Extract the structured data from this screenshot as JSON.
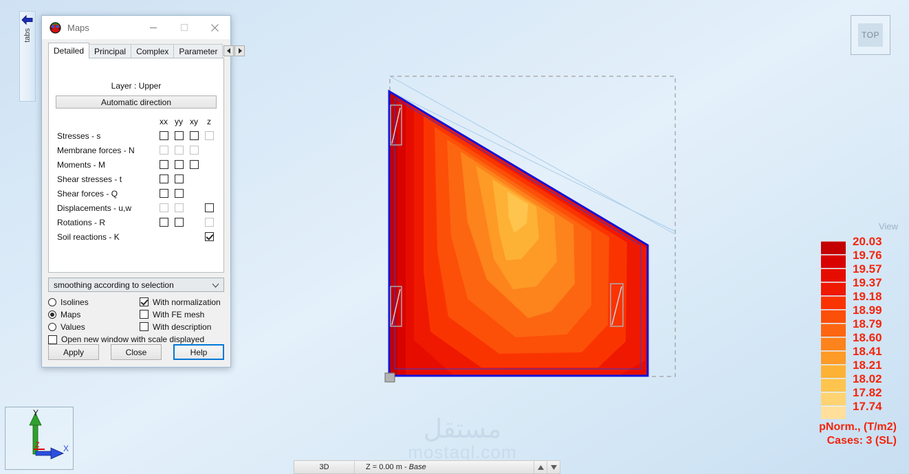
{
  "app": {
    "tabs_strip_label": "tabs",
    "tabs_strip_icon": "left-arrow-icon",
    "view_cube_label": "TOP",
    "view_label": "View",
    "watermark_arabic": "مستقل",
    "watermark_latin": "mostaql.com",
    "axis_labels": {
      "x": "X",
      "y": "Y",
      "z": "Z"
    }
  },
  "status_bar": {
    "mode": "3D",
    "z_prefix": "Z = 0.00 m - ",
    "z_suffix": "Base",
    "spin_up_icon": "triangle-up-icon",
    "spin_down_icon": "triangle-down-icon"
  },
  "dialog": {
    "title": "Maps",
    "icon": "maps-globe-icon",
    "minimize_icon": "minimize-icon",
    "maximize_icon": "maximize-icon",
    "close_icon": "close-icon",
    "tabs": [
      {
        "label": "Detailed",
        "active": true
      },
      {
        "label": "Principal",
        "active": false
      },
      {
        "label": "Complex",
        "active": false
      },
      {
        "label": "Parameter",
        "active": false
      }
    ],
    "tab_scroll_left_icon": "chevron-left-icon",
    "tab_scroll_right_icon": "chevron-right-icon",
    "layer_text": "Layer : Upper",
    "auto_direction_label": "Automatic direction",
    "component_headers": [
      "xx",
      "yy",
      "xy",
      "z"
    ],
    "component_rows": [
      {
        "label": "Stresses - s",
        "xx": "unchecked",
        "yy": "unchecked",
        "xy": "unchecked",
        "z": "disabled"
      },
      {
        "label": "Membrane forces - N",
        "xx": "disabled",
        "yy": "disabled",
        "xy": "disabled",
        "z": "none"
      },
      {
        "label": "Moments - M",
        "xx": "unchecked",
        "yy": "unchecked",
        "xy": "unchecked",
        "z": "none"
      },
      {
        "label": "Shear stresses - t",
        "xx": "unchecked",
        "yy": "unchecked",
        "xy": "none",
        "z": "none"
      },
      {
        "label": "Shear forces - Q",
        "xx": "unchecked",
        "yy": "unchecked",
        "xy": "none",
        "z": "none"
      },
      {
        "label": "Displacements - u,w",
        "xx": "disabled",
        "yy": "disabled",
        "xy": "none",
        "z": "unchecked"
      },
      {
        "label": "Rotations - R",
        "xx": "unchecked",
        "yy": "unchecked",
        "xy": "none",
        "z": "disabled"
      },
      {
        "label": "Soil reactions - K",
        "xx": "none",
        "yy": "none",
        "xy": "none",
        "z": "checked"
      }
    ],
    "smoothing_value": "smoothing according to selection",
    "smoothing_icon": "chevron-down-icon",
    "display_mode": [
      {
        "label": "Isolines",
        "selected": false
      },
      {
        "label": "Maps",
        "selected": true
      },
      {
        "label": "Values",
        "selected": false
      }
    ],
    "display_options": [
      {
        "label": "With normalization",
        "checked": true
      },
      {
        "label": "With FE mesh",
        "checked": false
      },
      {
        "label": "With description",
        "checked": false
      }
    ],
    "open_new_window": {
      "label": "Open new window with scale displayed",
      "checked": false
    },
    "buttons": [
      {
        "label": "Apply",
        "default": false
      },
      {
        "label": "Close",
        "default": false
      },
      {
        "label": "Help",
        "default": true
      }
    ]
  },
  "chart_data": {
    "type": "heatmap",
    "title": "pNorm., (T/m2)",
    "subtitle": "Cases: 3 (SL)",
    "quantity": "pNorm.",
    "units": "T/m2",
    "cases": "3 (SL)",
    "legend_position": "right",
    "legend_labels": [
      "20.03",
      "19.76",
      "19.57",
      "19.37",
      "19.18",
      "18.99",
      "18.79",
      "18.60",
      "18.41",
      "18.21",
      "18.02",
      "17.82",
      "17.74"
    ],
    "legend_values": [
      20.03,
      19.76,
      19.57,
      19.37,
      19.18,
      18.99,
      18.79,
      18.6,
      18.41,
      18.21,
      18.02,
      17.82,
      17.74
    ],
    "legend_colors": [
      "#c40000",
      "#d80300",
      "#e60d00",
      "#ef1800",
      "#fa3400",
      "#fc4f08",
      "#fd6610",
      "#fd831c",
      "#fe9a26",
      "#feb235",
      "#ffc44d",
      "#ffd372",
      "#ffdf9a"
    ],
    "value_min": 17.74,
    "value_max": 20.03,
    "band_count": 12,
    "contour_min_label": "17.74",
    "contour_max_label": "20.03",
    "geometry_note": "pentagonal slab plan, chamfered upper-right corner",
    "grid": false
  }
}
